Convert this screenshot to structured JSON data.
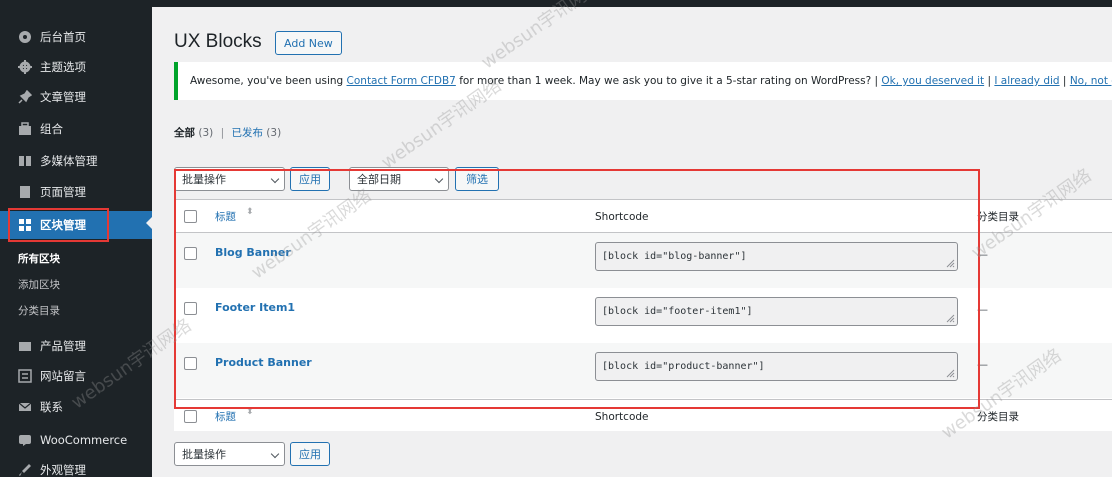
{
  "sidebar": {
    "items": [
      {
        "icon": "dashboard-icon",
        "label": "后台首页"
      },
      {
        "icon": "settings-icon",
        "label": "主题选项"
      },
      {
        "icon": "pin-icon",
        "label": "文章管理"
      },
      {
        "icon": "portfolio-icon",
        "label": "组合"
      },
      {
        "icon": "media-icon",
        "label": "多媒体管理"
      },
      {
        "icon": "page-icon",
        "label": "页面管理"
      },
      {
        "icon": "blocks-icon",
        "label": "区块管理"
      }
    ],
    "submenu": [
      "所有区块",
      "添加区块",
      "分类目录"
    ],
    "items_below": [
      {
        "icon": "products-icon",
        "label": "产品管理"
      },
      {
        "icon": "comments-icon",
        "label": "网站留言"
      },
      {
        "icon": "mail-icon",
        "label": "联系"
      },
      {
        "icon": "woocommerce-icon",
        "label": "WooCommerce"
      },
      {
        "icon": "appearance-icon",
        "label": "外观管理"
      }
    ]
  },
  "header": {
    "title": "UX Blocks",
    "add_new": "Add New"
  },
  "notice": {
    "text": "Awesome, you've been using ",
    "plugin_link": "Contact Form CFDB7",
    "text2": " for more than 1 week. May we ask you to give it a 5-star rating on WordPress? | ",
    "link1": "Ok, you deserved it",
    "sep1": " | ",
    "link2": "I already did",
    "sep2": " | ",
    "link3": "No, not good enough"
  },
  "filters": {
    "all_label": "全部",
    "all_count": "(3)",
    "published_label": "已发布",
    "published_count": "(3)"
  },
  "bulk": {
    "action": "批量操作",
    "apply": "应用",
    "date": "全部日期",
    "filter": "筛选"
  },
  "table": {
    "columns": [
      "标题",
      "Shortcode",
      "分类目录"
    ],
    "rows": [
      {
        "title": "Blog Banner",
        "shortcode": "[block id=\"blog-banner\"]",
        "category": "—"
      },
      {
        "title": "Footer Item1",
        "shortcode": "[block id=\"footer-item1\"]",
        "category": "—"
      },
      {
        "title": "Product Banner",
        "shortcode": "[block id=\"product-banner\"]",
        "category": "—"
      }
    ]
  },
  "watermark": "websun宇讯网络",
  "colors": {
    "sidebar_bg": "#1d2327",
    "accent": "#2271b1",
    "highlight_red": "#e53935",
    "notice_green": "#00a32a"
  }
}
